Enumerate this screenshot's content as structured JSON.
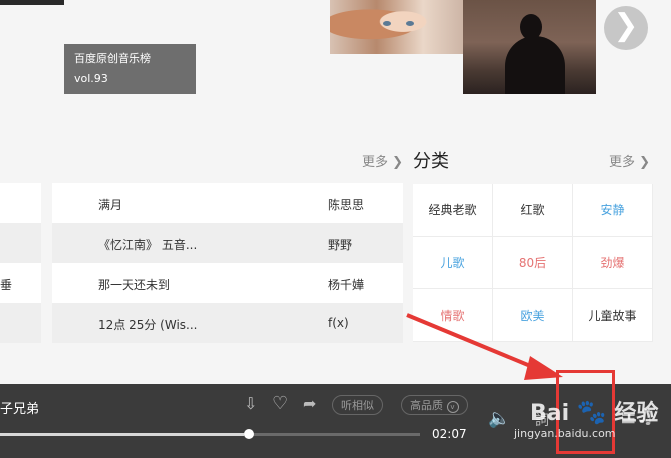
{
  "banner": {
    "album_title": "百度原创音乐榜",
    "album_vol": "vol.93",
    "next_glyph": "❯"
  },
  "sections": {
    "more_left": "更多",
    "more_right": "更多",
    "more_arrow": "❯",
    "category_title": "分类"
  },
  "songs": [
    {
      "title": "满月",
      "artist": "陈思思",
      "left_cut": ""
    },
    {
      "title": "《忆江南》 五音...",
      "artist": "野野",
      "left_cut": ""
    },
    {
      "title": "那一天还未到",
      "artist": "杨千嬅",
      "left_cut": "垂"
    },
    {
      "title": "12点 25分 (Wis...",
      "artist": "f(x)",
      "left_cut": ""
    }
  ],
  "categories": [
    {
      "label": "经典老歌",
      "color": "#333333"
    },
    {
      "label": "红歌",
      "color": "#333333"
    },
    {
      "label": "安静",
      "color": "#4aa3df"
    },
    {
      "label": "儿歌",
      "color": "#4aa3df"
    },
    {
      "label": "80后",
      "color": "#e57373"
    },
    {
      "label": "劲爆",
      "color": "#e57373"
    },
    {
      "label": "情歌",
      "color": "#e57373"
    },
    {
      "label": "欧美",
      "color": "#4aa3df"
    },
    {
      "label": "儿童故事",
      "color": "#333333"
    }
  ],
  "player": {
    "now_playing": "子兄弟",
    "similar_label": "听相似",
    "quality_label": "高品质",
    "time": "02:07",
    "progress": 0.58,
    "icons": {
      "download": "⇩",
      "like": "♡",
      "share": "➦",
      "volume": "🔈",
      "lyrics": "詞",
      "playlist": "≡",
      "music_note": "♫"
    }
  },
  "watermark": {
    "brand": "Bai",
    "brand_suffix": "经验",
    "url": "jingyan.baidu.com"
  }
}
